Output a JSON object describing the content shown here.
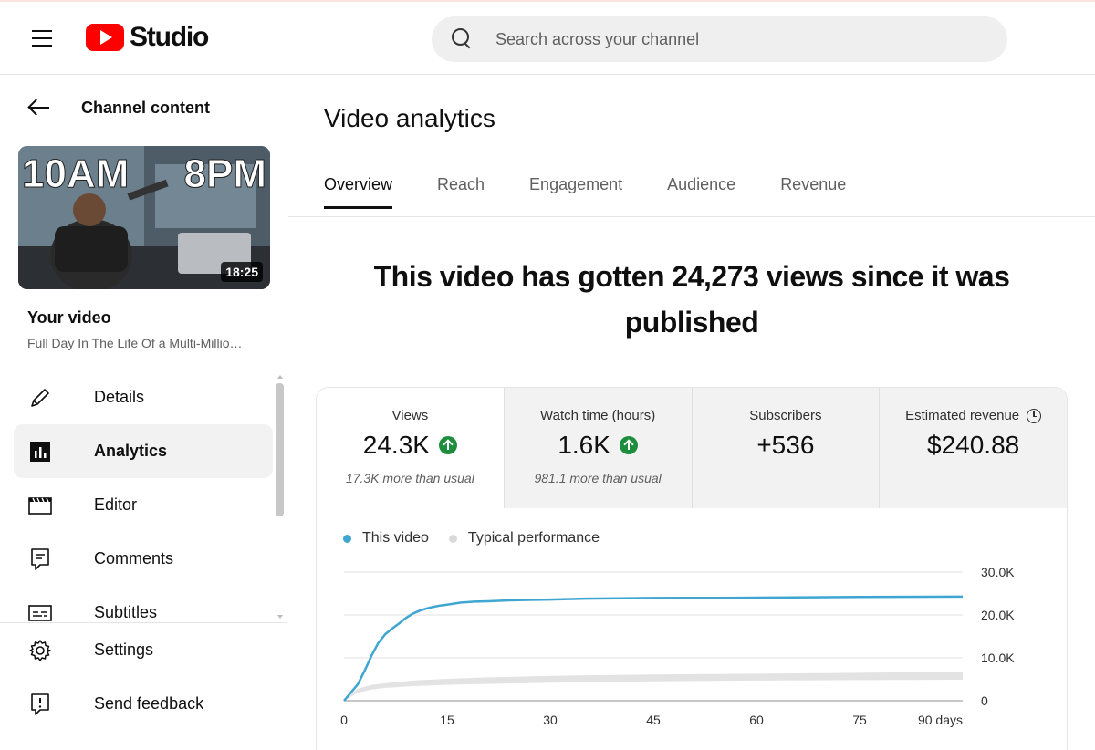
{
  "header": {
    "logo_text": "Studio",
    "search_placeholder": "Search across your channel"
  },
  "sidebar": {
    "back_label": "Channel content",
    "thumbnail": {
      "text_left": "10AM",
      "text_right": "8PM",
      "duration": "18:25"
    },
    "your_video_label": "Your video",
    "video_title": "Full Day In The Life Of a Multi-Millio…",
    "items": [
      {
        "label": "Details",
        "icon": "pencil-icon"
      },
      {
        "label": "Analytics",
        "icon": "analytics-icon",
        "active": true
      },
      {
        "label": "Editor",
        "icon": "clapperboard-icon"
      },
      {
        "label": "Comments",
        "icon": "comment-icon"
      },
      {
        "label": "Subtitles",
        "icon": "subtitles-icon"
      }
    ],
    "bottom_items": [
      {
        "label": "Settings",
        "icon": "gear-icon"
      },
      {
        "label": "Send feedback",
        "icon": "feedback-icon"
      }
    ]
  },
  "main": {
    "title": "Video analytics",
    "tabs": [
      {
        "label": "Overview",
        "active": true
      },
      {
        "label": "Reach"
      },
      {
        "label": "Engagement"
      },
      {
        "label": "Audience"
      },
      {
        "label": "Revenue"
      }
    ],
    "headline": "This video has gotten 24,273 views since it was published",
    "metrics": [
      {
        "label": "Views",
        "value": "24.3K",
        "note": "17.3K more than usual",
        "trend": "up"
      },
      {
        "label": "Watch time (hours)",
        "value": "1.6K",
        "note": "981.1 more than usual",
        "trend": "up"
      },
      {
        "label": "Subscribers",
        "value": "+536",
        "note": ""
      },
      {
        "label": "Estimated revenue",
        "value": "$240.88",
        "note": ""
      }
    ]
  },
  "chart_data": {
    "type": "line",
    "series": [
      {
        "name": "This video",
        "color": "#3ea6d1",
        "x": [
          0,
          1,
          2,
          3,
          4,
          5,
          6,
          7,
          8,
          9,
          10,
          11,
          12,
          13,
          14,
          15,
          17,
          19,
          21,
          24,
          27,
          30,
          35,
          40,
          45,
          50,
          55,
          60,
          65,
          70,
          75,
          80,
          85,
          90
        ],
        "y": [
          0,
          1900,
          3800,
          7000,
          10500,
          13500,
          15500,
          16800,
          18000,
          19300,
          20300,
          21000,
          21500,
          21900,
          22200,
          22400,
          22900,
          23100,
          23200,
          23400,
          23500,
          23600,
          23800,
          23900,
          23950,
          24000,
          24000,
          24050,
          24100,
          24150,
          24200,
          24230,
          24260,
          24273
        ]
      },
      {
        "name": "Typical performance",
        "color": "#d9d9d9",
        "type": "band",
        "x": [
          0,
          1,
          2,
          4,
          6,
          8,
          10,
          15,
          20,
          30,
          45,
          60,
          75,
          90
        ],
        "low": [
          0,
          900,
          1900,
          2600,
          3000,
          3200,
          3400,
          3700,
          3900,
          4200,
          4500,
          4700,
          4800,
          4900
        ],
        "high": [
          0,
          1500,
          2800,
          3700,
          4100,
          4400,
          4700,
          5100,
          5400,
          5800,
          6100,
          6300,
          6500,
          6800
        ]
      }
    ],
    "x_ticks": [
      "0",
      "15",
      "30",
      "45",
      "60",
      "75",
      "90 days"
    ],
    "x_tick_values": [
      0,
      15,
      30,
      45,
      60,
      75,
      90
    ],
    "y_ticks": [
      "0",
      "10.0K",
      "20.0K",
      "30.0K"
    ],
    "y_tick_values": [
      0,
      10000,
      20000,
      30000
    ],
    "xlim": [
      0,
      90
    ],
    "ylim": [
      0,
      30000
    ],
    "grid": true
  }
}
